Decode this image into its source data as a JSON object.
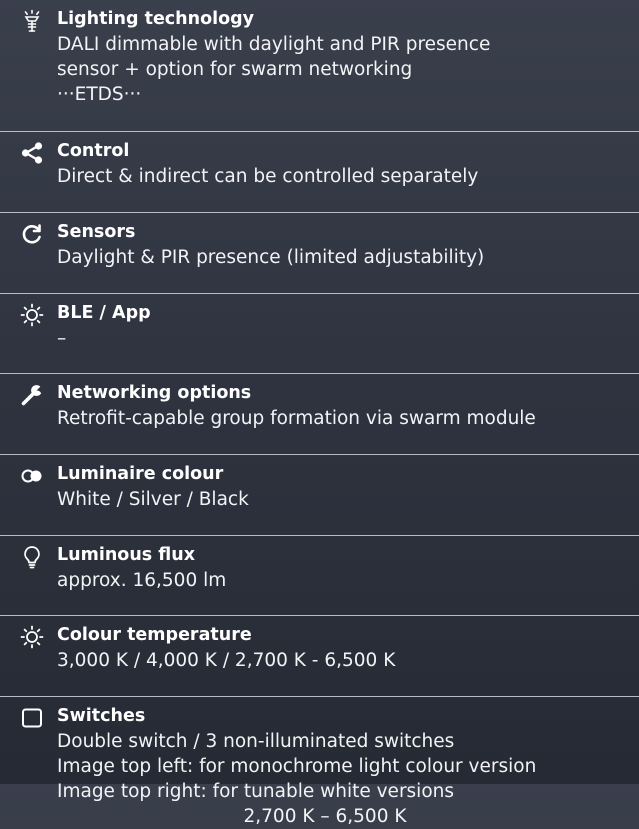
{
  "specs": [
    {
      "icon": "lamp-icon",
      "title": "Lighting technology",
      "lines": [
        "DALI dimmable with daylight and PIR presence",
        "sensor + option for swarm networking",
        "···ETDS···"
      ]
    },
    {
      "icon": "share-icon",
      "title": "Control",
      "lines": [
        "Direct & indirect can be controlled separately"
      ]
    },
    {
      "icon": "refresh-icon",
      "title": "Sensors",
      "lines": [
        "Daylight & PIR presence (limited adjustability)"
      ]
    },
    {
      "icon": "sun-icon",
      "title": "BLE / App",
      "lines": [
        "–"
      ]
    },
    {
      "icon": "wrench-icon",
      "title": "Networking options",
      "lines": [
        "Retrofit-capable group formation via swarm module"
      ]
    },
    {
      "icon": "colour-circles-icon",
      "title": "Luminaire colour",
      "lines": [
        "White / Silver / Black"
      ]
    },
    {
      "icon": "lightbulb-icon",
      "title": "Luminous flux",
      "lines": [
        "approx.  16,500 lm"
      ]
    },
    {
      "icon": "sun-icon",
      "title": "Colour temperature",
      "lines": [
        "3,000 K / 4,000 K / 2,700 K - 6,500 K"
      ]
    },
    {
      "icon": "square-icon",
      "title": "Switches",
      "lines": [
        "Double switch / 3 non-illuminated switches",
        "Image top left: for monochrome light colour version",
        "Image top right: for tunable white versions",
        "2,700 K – 6,500 K"
      ]
    }
  ],
  "colors": {
    "background_top": "#3a3f4c",
    "background_bottom": "#262a34",
    "text": "#ffffff",
    "divider": "#b9bcc4"
  }
}
